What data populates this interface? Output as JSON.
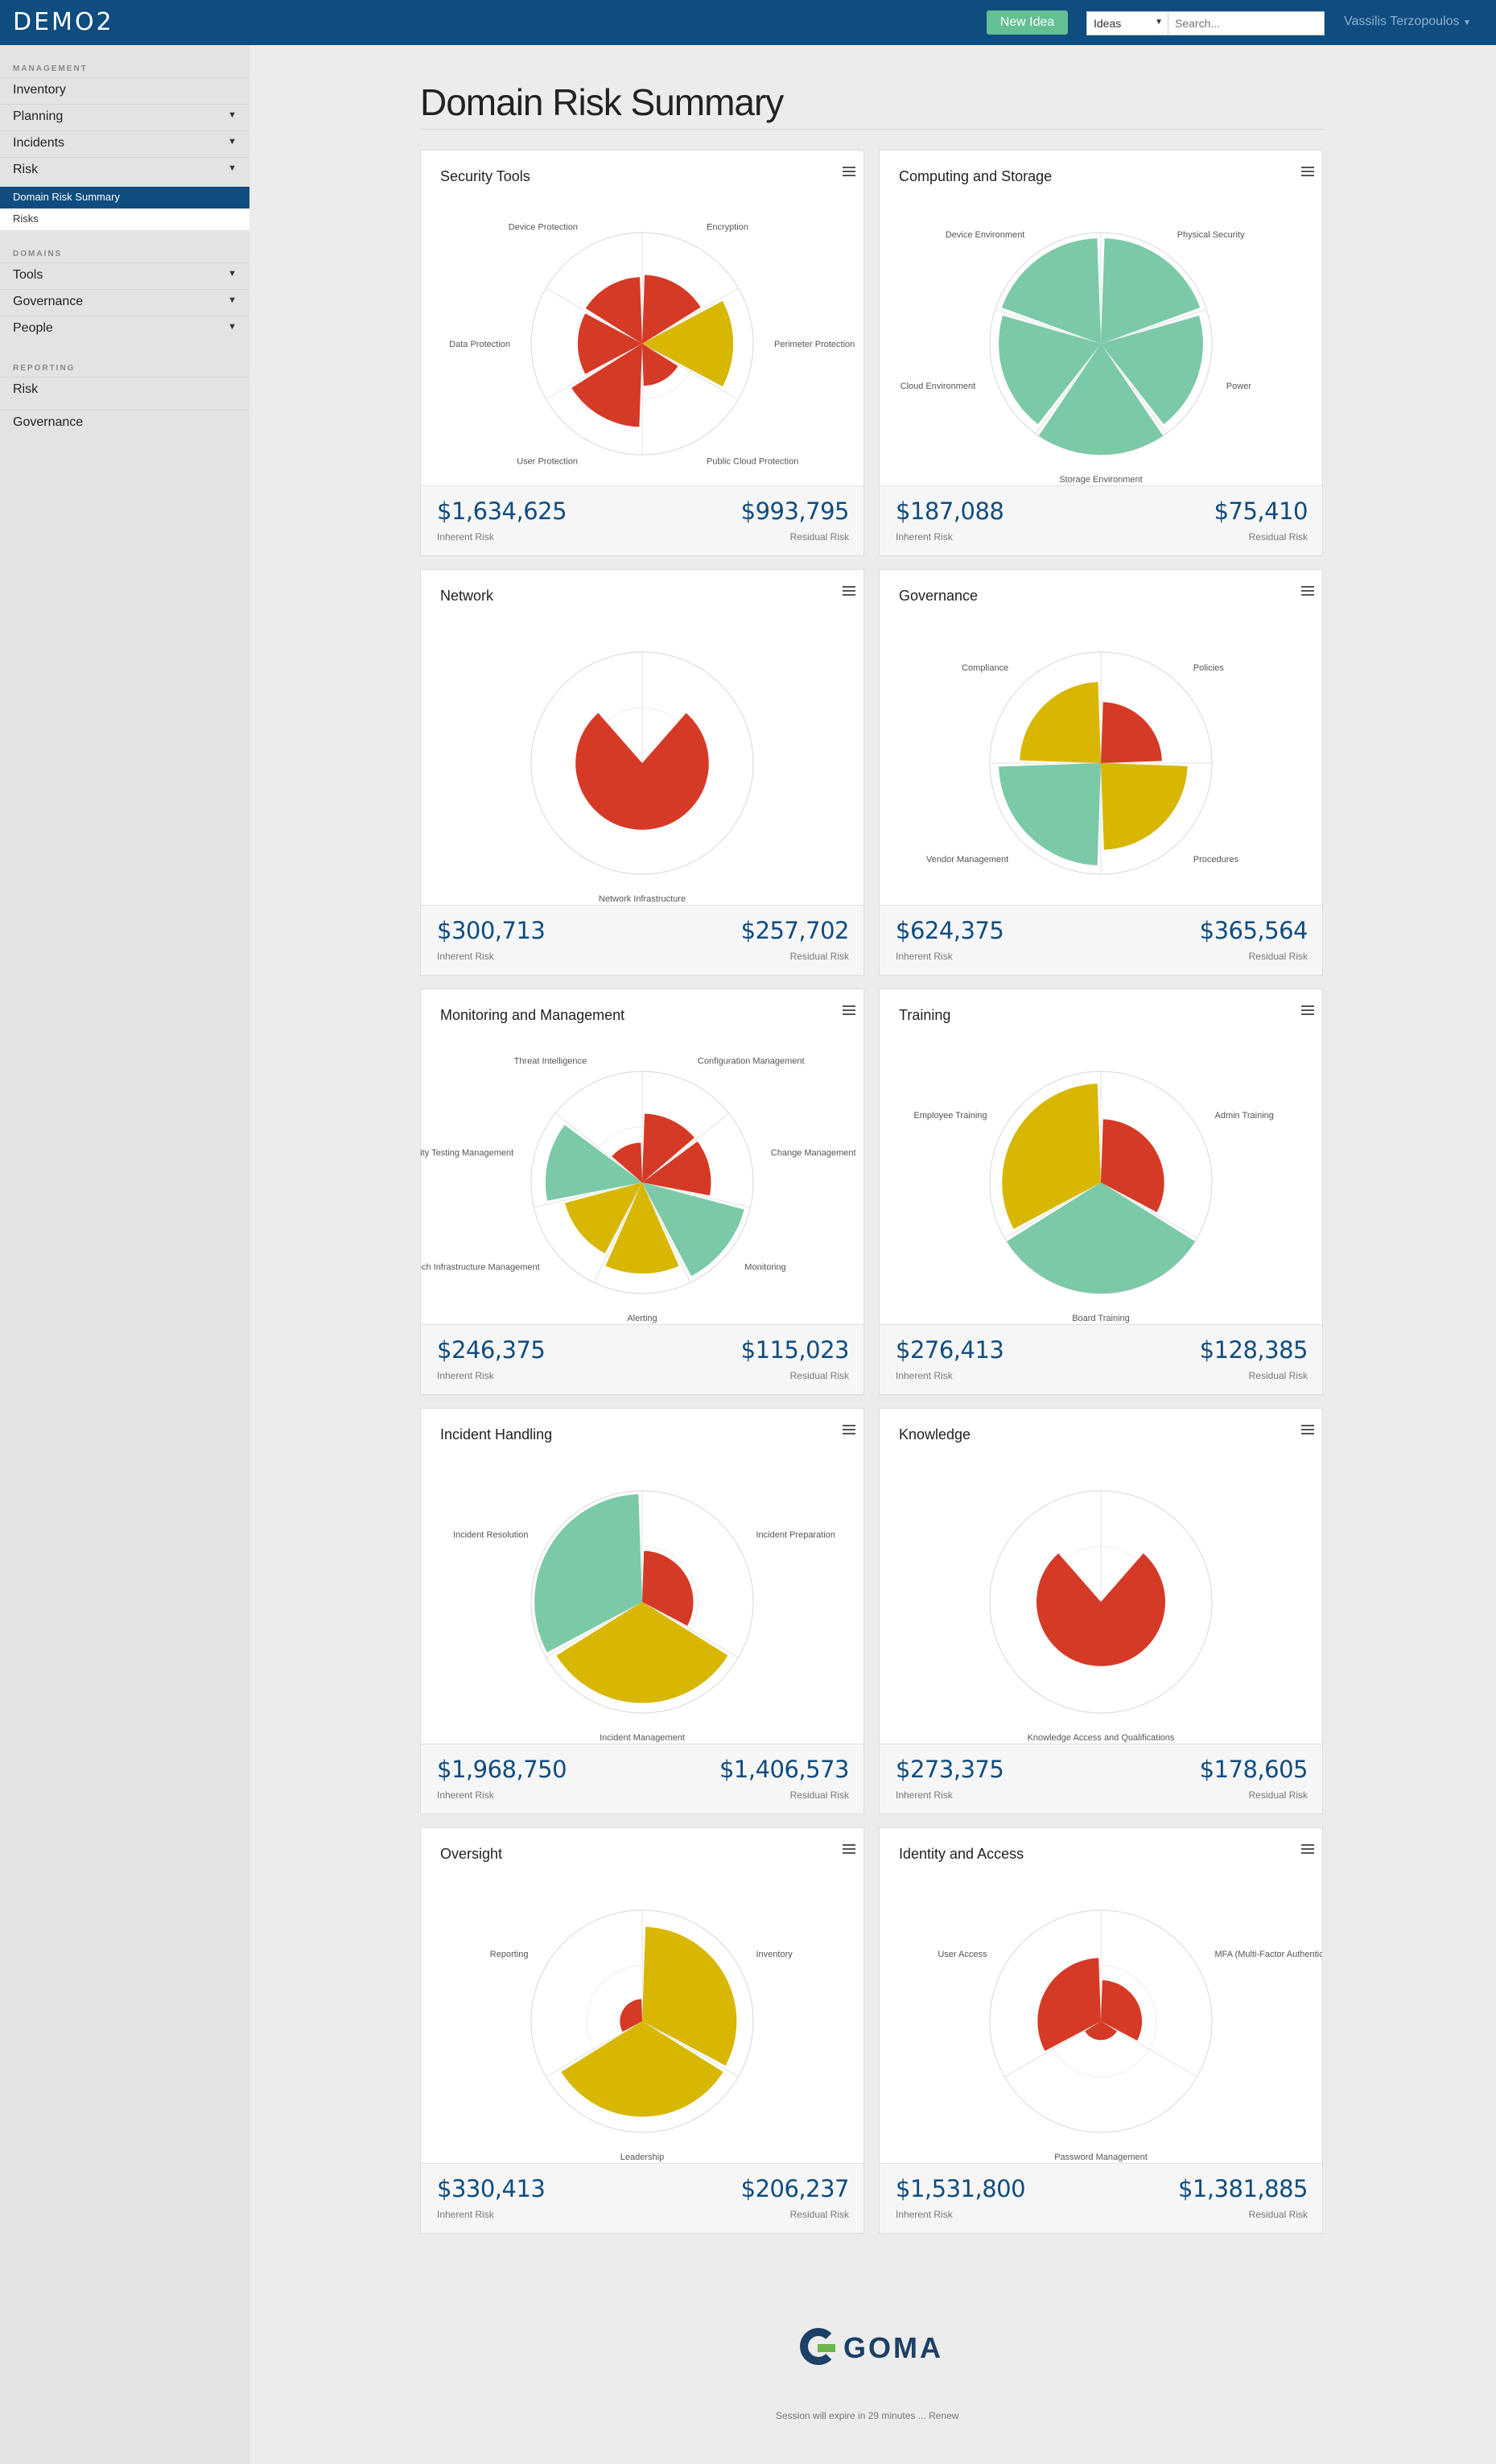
{
  "app": {
    "brand": "DEMO2",
    "user": "Vassilis Terzopoulos"
  },
  "topbar": {
    "new_idea_label": "New Idea",
    "ideas_select": "Ideas",
    "search_placeholder": "Search..."
  },
  "sidebar": {
    "management_title": "MANAGEMENT",
    "management_items": [
      "Inventory",
      "Planning",
      "Incidents",
      "Risk"
    ],
    "risk_subitems": [
      "Domain Risk Summary",
      "Risks"
    ],
    "domains_title": "DOMAINS",
    "domains_items": [
      "Tools",
      "Governance",
      "People"
    ],
    "reporting_title": "REPORTING",
    "reporting_items": [
      "Risk",
      "Governance"
    ]
  },
  "page": {
    "title": "Domain Risk Summary",
    "inherent_label": "Inherent Risk",
    "residual_label": "Residual Risk"
  },
  "colors": {
    "red": "#d53a26",
    "yellow": "#d7b701",
    "green": "#7bc9a7",
    "brand": "#0f4c7f"
  },
  "cards": [
    {
      "title": "Security Tools",
      "inherent": "$1,634,625",
      "residual": "$993,795",
      "chart_data": {
        "type": "polar-area",
        "rmax": 100,
        "categories": [
          "Encryption",
          "Perimeter Protection",
          "Public Cloud Protection",
          "User Protection",
          "Data Protection",
          "Device Protection"
        ],
        "values": [
          62,
          82,
          38,
          75,
          58,
          60
        ],
        "colors": [
          "red",
          "yellow",
          "red",
          "red",
          "red",
          "red"
        ]
      }
    },
    {
      "title": "Computing and Storage",
      "inherent": "$187,088",
      "residual": "$75,410",
      "chart_data": {
        "type": "polar-area",
        "rmax": 100,
        "categories": [
          "Physical Security",
          "Power",
          "Storage Environment",
          "Cloud Environment",
          "Device Environment"
        ],
        "values": [
          95,
          92,
          100,
          92,
          95
        ],
        "colors": [
          "green",
          "green",
          "green",
          "green",
          "green"
        ]
      }
    },
    {
      "title": "Network",
      "inherent": "$300,713",
      "residual": "$257,702",
      "chart_data": {
        "type": "polar-area",
        "rmax": 100,
        "categories": [
          "Network Infrastructure"
        ],
        "values": [
          60
        ],
        "colors": [
          "red"
        ]
      }
    },
    {
      "title": "Governance",
      "inherent": "$624,375",
      "residual": "$365,564",
      "chart_data": {
        "type": "polar-area",
        "rmax": 100,
        "categories": [
          "Policies",
          "Procedures",
          "Vendor Management",
          "Compliance"
        ],
        "values": [
          55,
          78,
          92,
          73
        ],
        "colors": [
          "red",
          "yellow",
          "green",
          "yellow"
        ]
      }
    },
    {
      "title": "Monitoring and Management",
      "inherent": "$246,375",
      "residual": "$115,023",
      "chart_data": {
        "type": "polar-area",
        "rmax": 100,
        "categories": [
          "Configuration Management",
          "Change Management",
          "Monitoring",
          "Alerting",
          "Tech Infrastructure Management",
          "Cybersecurity Testing Management",
          "Threat Intelligence"
        ],
        "values": [
          62,
          62,
          95,
          82,
          72,
          87,
          36
        ],
        "colors": [
          "red",
          "red",
          "green",
          "yellow",
          "yellow",
          "green",
          "red"
        ]
      }
    },
    {
      "title": "Training",
      "inherent": "$276,413",
      "residual": "$128,385",
      "chart_data": {
        "type": "polar-area",
        "rmax": 100,
        "categories": [
          "Admin Training",
          "Board Training",
          "Employee Training"
        ],
        "values": [
          57,
          100,
          89
        ],
        "colors": [
          "red",
          "green",
          "yellow"
        ]
      }
    },
    {
      "title": "Incident Handling",
      "inherent": "$1,968,750",
      "residual": "$1,406,573",
      "chart_data": {
        "type": "polar-area",
        "rmax": 100,
        "categories": [
          "Incident Preparation",
          "Incident Management",
          "Incident Resolution"
        ],
        "values": [
          46,
          91,
          97
        ],
        "colors": [
          "red",
          "yellow",
          "green"
        ]
      }
    },
    {
      "title": "Knowledge",
      "inherent": "$273,375",
      "residual": "$178,605",
      "chart_data": {
        "type": "polar-area",
        "rmax": 100,
        "categories": [
          "Knowledge Access and Qualifications"
        ],
        "values": [
          58
        ],
        "colors": [
          "red"
        ]
      }
    },
    {
      "title": "Oversight",
      "inherent": "$330,413",
      "residual": "$206,237",
      "chart_data": {
        "type": "polar-area",
        "rmax": 100,
        "categories": [
          "Inventory",
          "Leadership",
          "Reporting"
        ],
        "values": [
          85,
          86,
          20
        ],
        "colors": [
          "yellow",
          "yellow",
          "red"
        ]
      }
    },
    {
      "title": "Identity and Access",
      "inherent": "$1,531,800",
      "residual": "$1,381,885",
      "chart_data": {
        "type": "polar-area",
        "rmax": 100,
        "categories": [
          "MFA (Multi-Factor Authentication)",
          "Password Management",
          "User Access"
        ],
        "values": [
          37,
          17,
          57
        ],
        "colors": [
          "red",
          "red",
          "red"
        ]
      }
    }
  ],
  "footer": {
    "logo_text": "GOMA",
    "session_text": "Session will expire in 29 minutes ... Renew"
  }
}
